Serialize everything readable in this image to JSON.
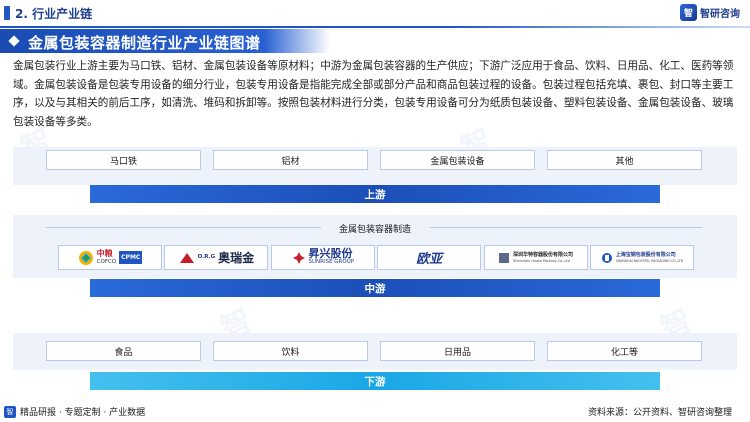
{
  "header": {
    "section_label": "2. 行业产业链",
    "brand_name": "智研咨询",
    "brand_logo_glyph": "智"
  },
  "title": "金属包装容器制造行业产业链图谱",
  "intro": "金属包装行业上游主要为马口铁、铝材、金属包装设备等原材料；中游为金属包装容器的生产供应；下游广泛应用于食品、饮料、日用品、化工、医药等领域。金属包装设备是包装专用设备的细分行业，包装专用设备是指能完成全部或部分产品和商品包装过程的设备。包装过程包括充填、裹包、封口等主要工序，以及与其相关的前后工序，如清洗、堆码和拆卸等。按照包装材料进行分类，包装专用设备可分为纸质包装设备、塑料包装设备、金属包装设备、玻璃包装设备等多类。",
  "upstream": {
    "items": [
      "马口铁",
      "铝材",
      "金属包装设备",
      "其他"
    ],
    "stage_label": "上游"
  },
  "midstream": {
    "title": "金属包装容器制造",
    "stage_label": "中游",
    "companies": [
      {
        "name": "中粮",
        "sub": "COFCO",
        "extra": "CPMC"
      },
      {
        "name": "奥瑞金",
        "sub": "O.R.G"
      },
      {
        "name": "昇兴股份",
        "sub": "SUNRISE GROUP"
      },
      {
        "name": "欧亚"
      },
      {
        "name": "深圳华特容器股份有限公司",
        "sub": "Shenzhen Huate Packing Co.,Ltd"
      },
      {
        "name": "上海宝钢包装股份有限公司",
        "sub": "SHANGHAI BAOSTEEL PACKAGING CO.,LTD"
      }
    ]
  },
  "downstream": {
    "items": [
      "食品",
      "饮料",
      "日用品",
      "化工等"
    ],
    "stage_label": "下游"
  },
  "footer": {
    "left": "精品研报 · 专题定制 · 产业数据",
    "right": "资料来源：公开资料、智研咨询整理"
  },
  "colors": {
    "primary": "#1f56c4",
    "downstream_bar": "#1aa7e6",
    "row_bg": "#eef3fb"
  }
}
